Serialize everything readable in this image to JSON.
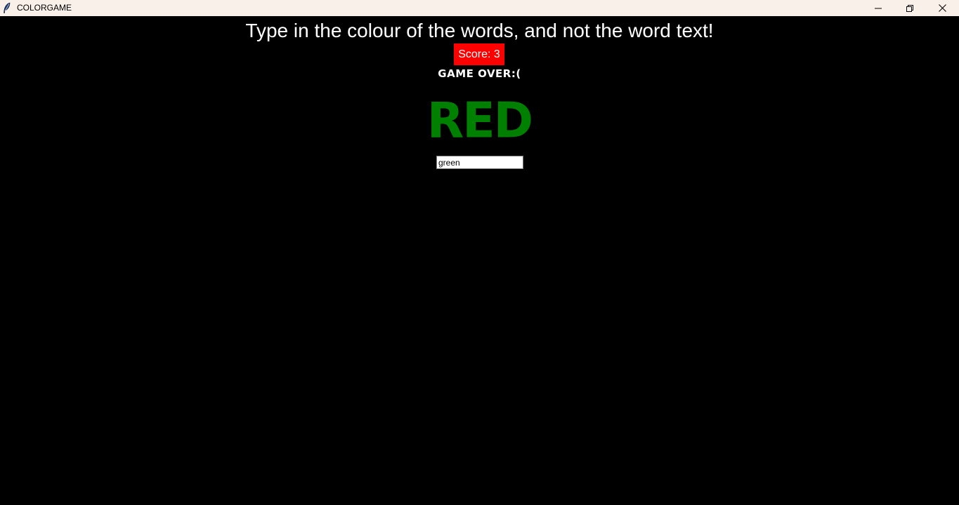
{
  "window": {
    "title": "COLORGAME",
    "icon": "feather-icon",
    "controls": {
      "minimize": "minimize-icon",
      "maximize": "restore-icon",
      "close": "close-icon"
    }
  },
  "game": {
    "instructions": "Type in the colour of the words, and not the word text!",
    "score_label": "Score: 3",
    "status": "GAME OVER:(",
    "color_word": "RED",
    "color_word_color": "#008000",
    "answer_value": "green"
  },
  "colors": {
    "background": "#000000",
    "titlebar": "#f9f0e9",
    "score_background": "#ff0000",
    "text": "#ffffff"
  }
}
